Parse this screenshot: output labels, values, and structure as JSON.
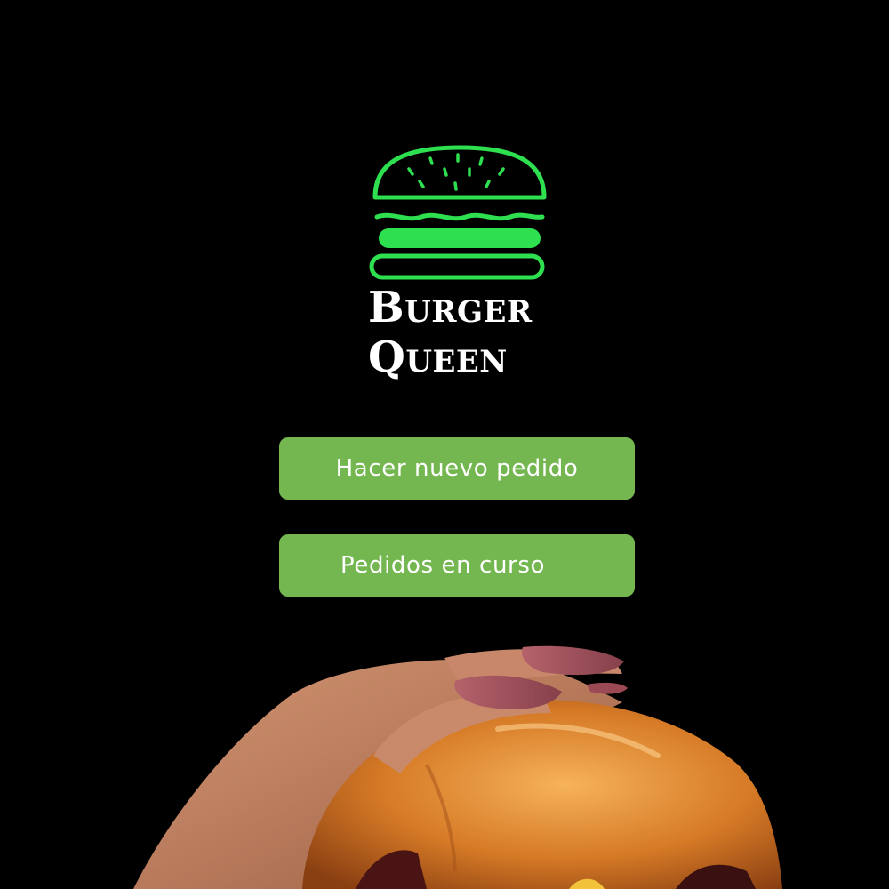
{
  "brand": {
    "line1": "Burger",
    "line2": "Queen"
  },
  "actions": {
    "new_order_label": "Hacer nuevo pedido",
    "orders_in_progress_label": "Pedidos en curso"
  },
  "icons": {
    "logo": "burger-icon"
  },
  "colors": {
    "background": "#000000",
    "logo_green": "#2ee04f",
    "button_green": "#74b751",
    "button_text": "#ffffff",
    "brand_text": "#ffffff"
  }
}
